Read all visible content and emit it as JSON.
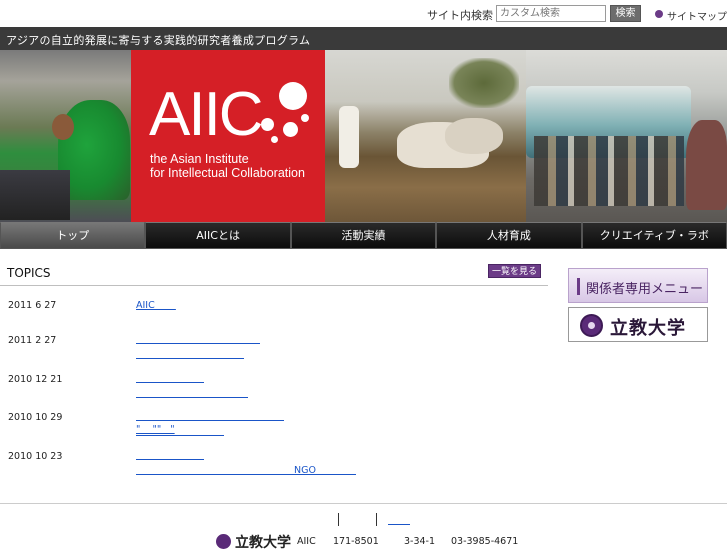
{
  "utility": {
    "site_search_label": "サイト内検索",
    "search_placeholder": "カスタム検索",
    "search_button": "検索",
    "sitemap_label": "サイトマップ"
  },
  "tagline": "アジアの自立的発展に寄与する実践的研究者養成プログラム",
  "logo": {
    "name": "AIIC",
    "subtitle_line1": "the Asian Institute",
    "subtitle_line2": "for Intellectual Collaboration"
  },
  "nav": {
    "items": [
      "トップ",
      "AIICとは",
      "活動実績",
      "人材育成",
      "クリエイティブ・ラボ"
    ]
  },
  "topics": {
    "title": "TOPICS",
    "more_button": "一覧を見る",
    "items": [
      {
        "date": "2011 6 27",
        "link": "AIIC       "
      },
      {
        "date": "2011 2 27",
        "link": ""
      },
      {
        "date": "2010 12 21",
        "link": ""
      },
      {
        "date": "2010 10 29",
        "link": "\"    \"\"   \""
      },
      {
        "date": "2010 10 23",
        "link": "NGO"
      }
    ]
  },
  "banners": {
    "members_menu": "関係者専用メニュー",
    "university": "立教大学"
  },
  "footer": {
    "university": "立教大学",
    "org": "AIIC",
    "postal": "171-8501",
    "address": "3-34-1",
    "phone": "03-3985-4671"
  },
  "colors": {
    "brand_red": "#d51f26",
    "accent_purple": "#6b3b87",
    "link_blue": "#1a55c8",
    "tagline_bg": "#3a3a3a"
  }
}
